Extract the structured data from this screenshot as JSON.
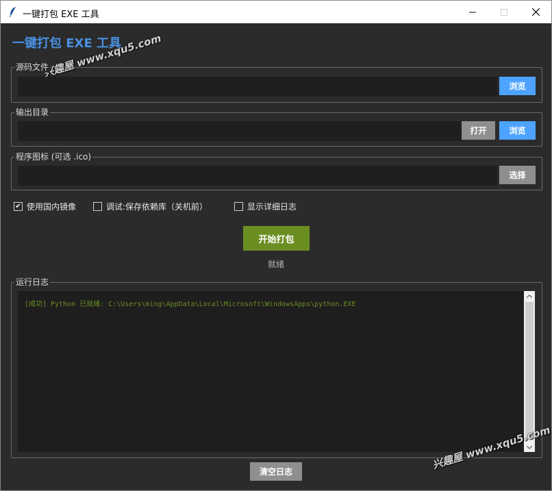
{
  "window": {
    "title": "一键打包 EXE 工具"
  },
  "app": {
    "title": "一键打包 EXE 工具"
  },
  "watermark": {
    "text": "兴趣屋 www.xqu5.com"
  },
  "source": {
    "label": "源码文件",
    "value": "",
    "browse": "浏览"
  },
  "output": {
    "label": "输出目录",
    "value": "",
    "open": "打开",
    "browse": "浏览"
  },
  "icon": {
    "label": "程序图标 (可选 .ico)",
    "value": "",
    "select": "选择"
  },
  "options": [
    {
      "label": "使用国内镜像",
      "checked": true
    },
    {
      "label": "调试:保存依赖库（关机前）",
      "checked": false
    },
    {
      "label": "显示详细日志",
      "checked": false
    }
  ],
  "actions": {
    "start": "开始打包",
    "status": "就绪",
    "clear": "清空日志"
  },
  "log": {
    "label": "运行日志",
    "lines": [
      "[成功] Python 已就绪: C:\\Users\\ming\\AppData\\Local\\Microsoft\\WindowsApps\\python.EXE"
    ]
  },
  "colors": {
    "accent": "#4a90e2",
    "primary_button": "#4da3ff",
    "start_button": "#6b8e23",
    "log_text": "#6b8e23",
    "background": "#2b2b2b"
  }
}
